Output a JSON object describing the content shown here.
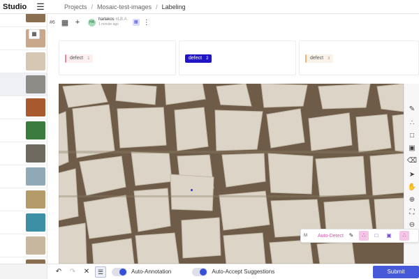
{
  "header": {
    "brand": "Studio",
    "breadcrumbs": [
      "Projects",
      "Mosaic-test-images",
      "Labeling"
    ],
    "separator": "/"
  },
  "taskbar": {
    "task_id": "#6",
    "user_initials": "HA",
    "user_name": "harlakos",
    "user_extra": "#LB.A",
    "user_time": "1 minute ago"
  },
  "labels": [
    {
      "name": "defect",
      "hotkey": "1",
      "color": "#e58a96",
      "selected": false
    },
    {
      "name": "defect",
      "hotkey": "2",
      "color": "#2215c8",
      "selected": true
    },
    {
      "name": "defect",
      "hotkey": "3",
      "color": "#e8b57a",
      "selected": false
    }
  ],
  "autobar": {
    "mode": "M",
    "label": "Auto-Detect"
  },
  "bottombar": {
    "auto_annotation_label": "Auto-Annotation",
    "auto_accept_label": "Auto-Accept Suggestions",
    "submit_label": "Submit"
  },
  "thumbnails": [
    {
      "color": "#8a6e50"
    },
    {
      "color": "#c9a78a"
    },
    {
      "color": "#d6c7b4"
    },
    {
      "color": "#8d8c86"
    },
    {
      "color": "#a85a2e"
    },
    {
      "color": "#3b7a3e"
    },
    {
      "color": "#6e6a60"
    },
    {
      "color": "#8faab6"
    },
    {
      "color": "#b59a6a"
    },
    {
      "color": "#3c8fa4"
    },
    {
      "color": "#c7b79f"
    }
  ],
  "colors": {
    "accent": "#4659d9",
    "selected_label": "#2215c8",
    "auto_detect_pink": "#d45aa7"
  }
}
